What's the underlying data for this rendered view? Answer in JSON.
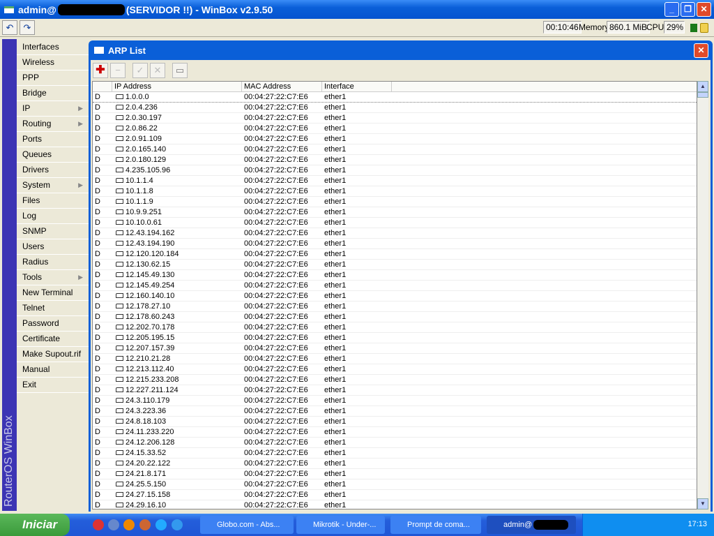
{
  "window": {
    "title_prefix": "admin@",
    "title_suffix": "(SERVIDOR !!) - WinBox v2.9.50"
  },
  "toolbar": {
    "undo": "↶",
    "redo": "↷",
    "uptime": "00:10:46",
    "memory_label": "Memory:",
    "memory": "860.1 MiB",
    "cpu_label": "CPU:",
    "cpu": "29%"
  },
  "strip_text": "RouterOS WinBox",
  "sidebar": {
    "items": [
      {
        "label": "Interfaces"
      },
      {
        "label": "Wireless"
      },
      {
        "label": "PPP"
      },
      {
        "label": "Bridge"
      },
      {
        "label": "IP",
        "sub": true
      },
      {
        "label": "Routing",
        "sub": true
      },
      {
        "label": "Ports"
      },
      {
        "label": "Queues"
      },
      {
        "label": "Drivers"
      },
      {
        "label": "System",
        "sub": true
      },
      {
        "label": "Files"
      },
      {
        "label": "Log"
      },
      {
        "label": "SNMP"
      },
      {
        "label": "Users"
      },
      {
        "label": "Radius"
      },
      {
        "label": "Tools",
        "sub": true
      },
      {
        "label": "New Terminal"
      },
      {
        "label": "Telnet"
      },
      {
        "label": "Password"
      },
      {
        "label": "Certificate"
      },
      {
        "label": "Make Supout.rif"
      },
      {
        "label": "Manual"
      },
      {
        "label": "Exit"
      }
    ]
  },
  "arp": {
    "title": "ARP List",
    "columns": [
      "IP Address",
      "MAC Address",
      "Interface"
    ],
    "flag": "D",
    "mac": "00:04:27:22:C7:E6",
    "iface": "ether1",
    "ips": [
      "1.0.0.0",
      "2.0.4.236",
      "2.0.30.197",
      "2.0.86.22",
      "2.0.91.109",
      "2.0.165.140",
      "2.0.180.129",
      "4.235.105.96",
      "10.1.1.4",
      "10.1.1.8",
      "10.1.1.9",
      "10.9.9.251",
      "10.10.0.61",
      "12.43.194.162",
      "12.43.194.190",
      "12.120.120.184",
      "12.130.62.15",
      "12.145.49.130",
      "12.145.49.254",
      "12.160.140.10",
      "12.178.27.10",
      "12.178.60.243",
      "12.202.70.178",
      "12.205.195.15",
      "12.207.157.39",
      "12.210.21.28",
      "12.213.112.40",
      "12.215.233.208",
      "12.227.211.124",
      "24.3.110.179",
      "24.3.223.36",
      "24.8.18.103",
      "24.11.233.220",
      "24.12.206.128",
      "24.15.33.52",
      "24.20.22.122",
      "24.21.8.171",
      "24.25.5.150",
      "24.27.15.158",
      "24.29.16.10"
    ]
  },
  "taskbar": {
    "start": "Iniciar",
    "tasks": [
      "Globo.com - Abs...",
      "Mikrotik - Under-...",
      "Prompt de coma...",
      "admin@"
    ],
    "clock": "17:13"
  }
}
